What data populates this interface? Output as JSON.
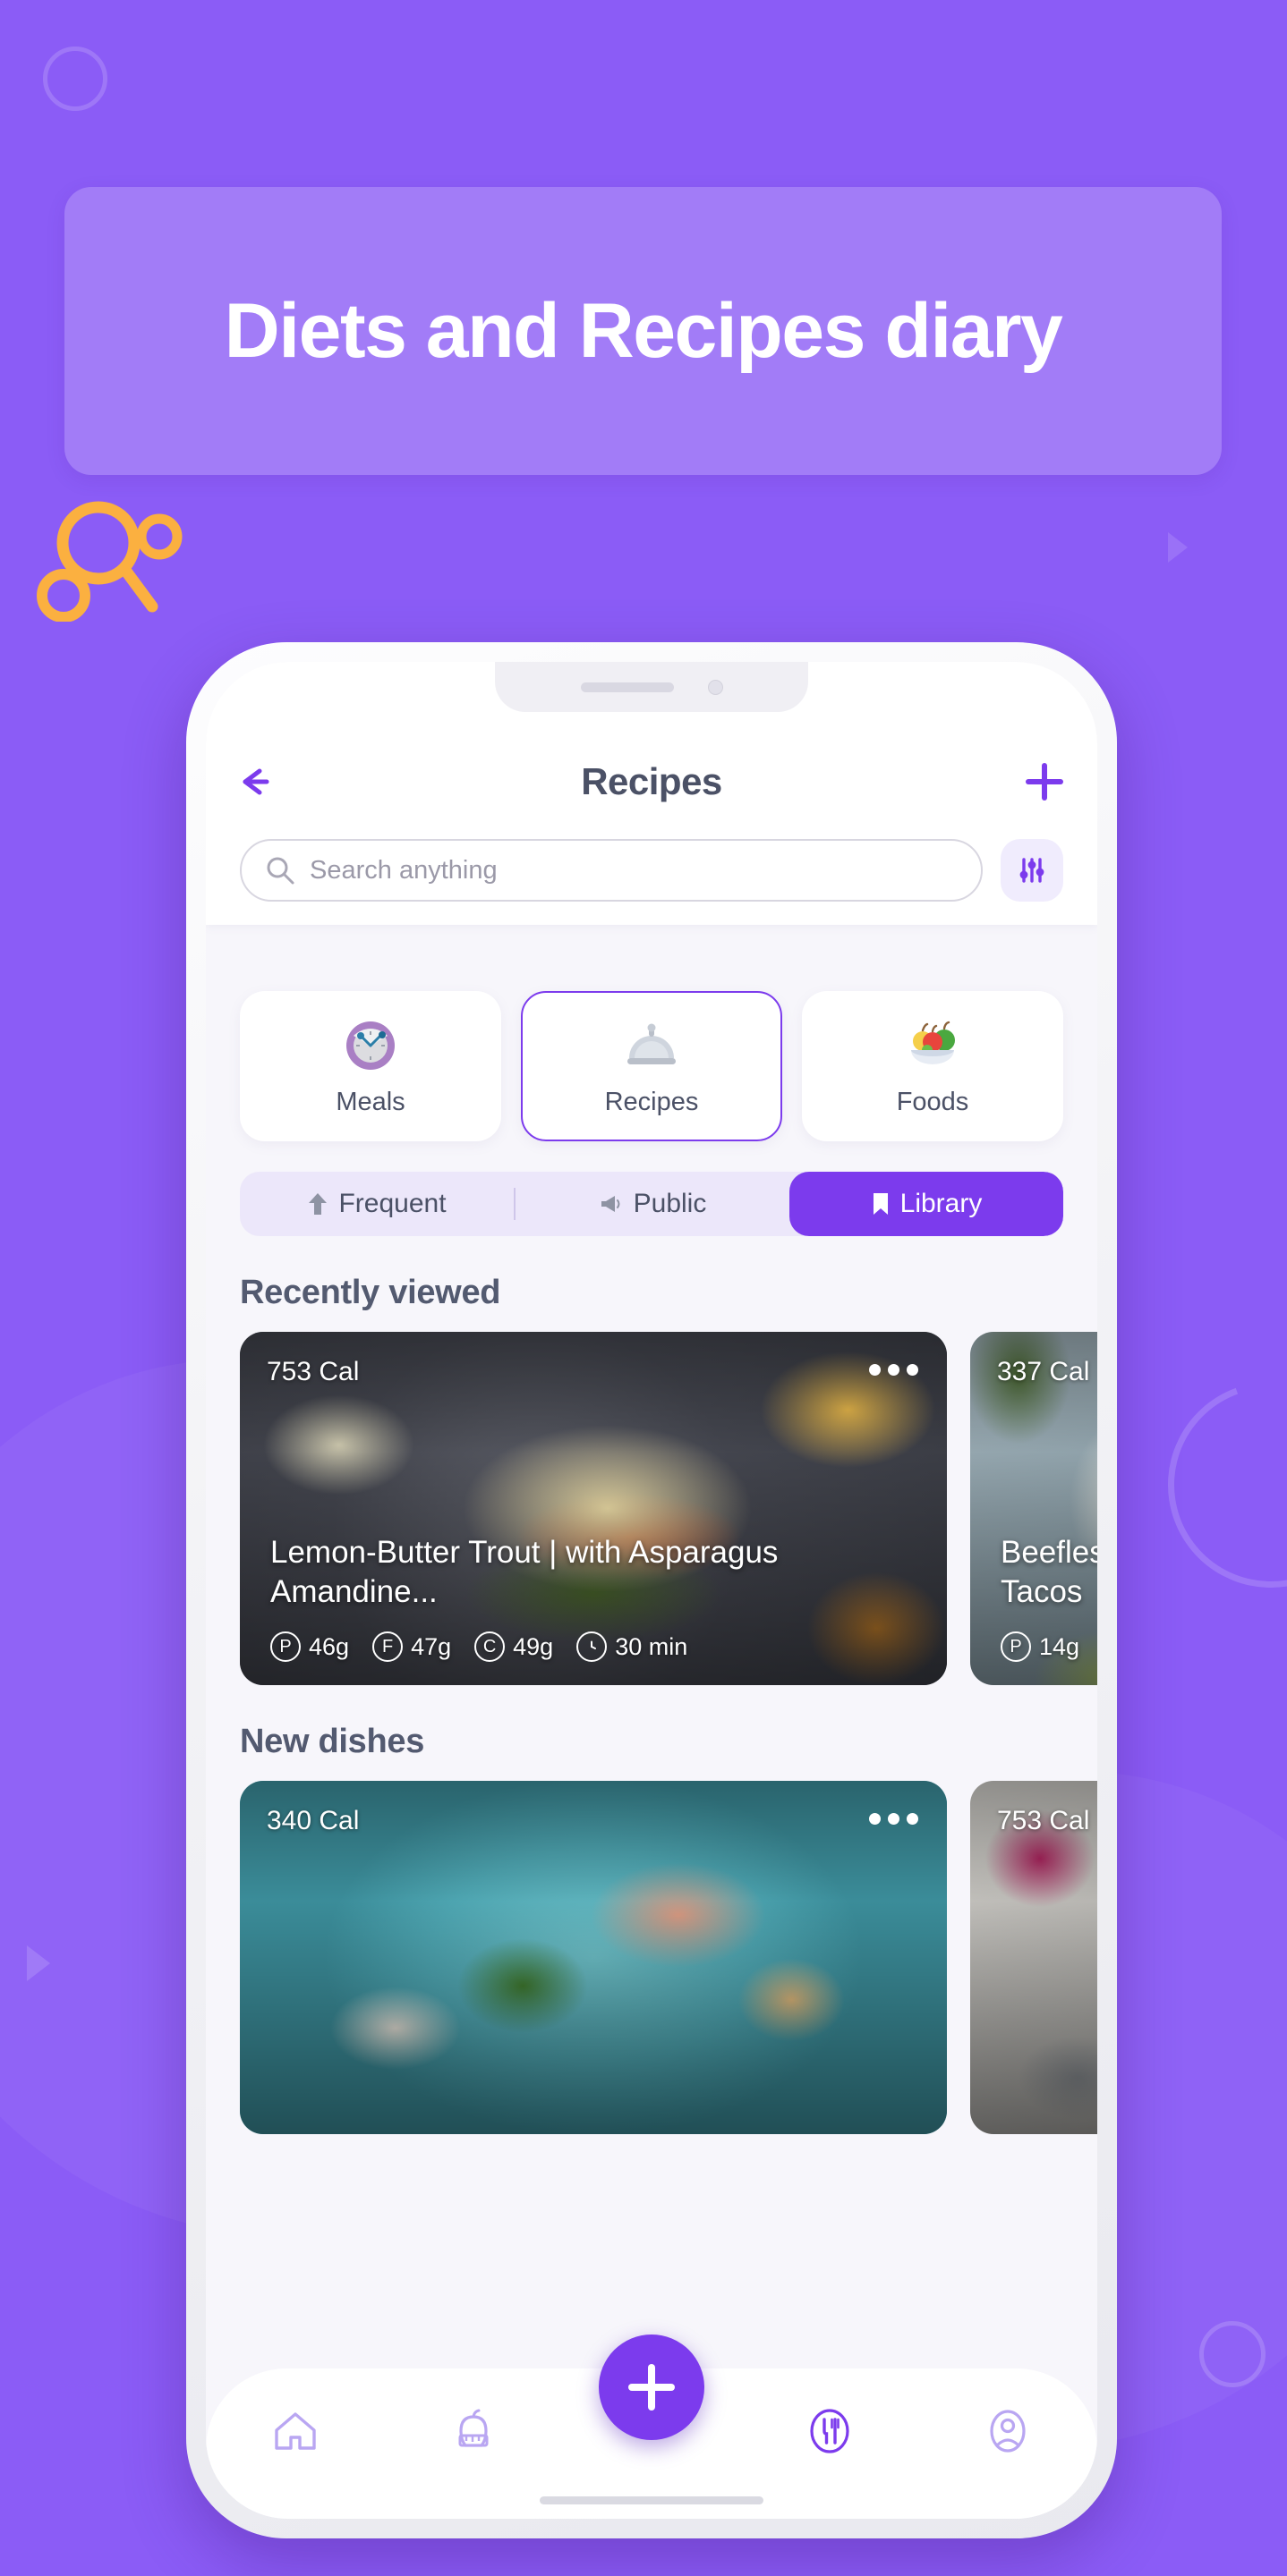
{
  "hero": {
    "title": "Diets and Recipes diary",
    "banner_bg": "rgba(255,255,255,0.20)"
  },
  "theme": {
    "page_bg": "#8B5CF6",
    "accent": "#7C3BED",
    "accent_soft": "#ECE7FA",
    "decor_orange": "#FBB040",
    "screen_bg": "#F7F6FB",
    "text_dark": "#4B5166"
  },
  "app": {
    "header": {
      "back_icon": "arrow-left-icon",
      "title": "Recipes",
      "add_icon": "plus-icon"
    },
    "search": {
      "icon": "search-icon",
      "placeholder": "Search anything",
      "value": "",
      "filter_icon": "sliders-icon"
    },
    "categories": [
      {
        "label": "Meals",
        "icon": "clock-icon",
        "active": false
      },
      {
        "label": "Recipes",
        "icon": "cloche-icon",
        "active": true
      },
      {
        "label": "Foods",
        "icon": "fruit-bowl-icon",
        "active": false
      }
    ],
    "segments": [
      {
        "label": "Frequent",
        "icon": "arrow-up-icon",
        "active": false
      },
      {
        "label": "Public",
        "icon": "megaphone-icon",
        "active": false
      },
      {
        "label": "Library",
        "icon": "bookmark-icon",
        "active": true
      }
    ],
    "sections": [
      {
        "title": "Recently viewed",
        "cards": [
          {
            "calories": "753 Cal",
            "title": "Lemon-Butter Trout | with Asparagus Amandine...",
            "menu_icon": "more-dots-icon",
            "macros": [
              {
                "key": "P",
                "value": "46g"
              },
              {
                "key": "F",
                "value": "47g"
              },
              {
                "key": "C",
                "value": "49g"
              },
              {
                "key": "clock",
                "value": "30 min"
              }
            ]
          },
          {
            "calories": "337 Cal",
            "title": "Beefless Tacos",
            "menu_icon": "more-dots-icon",
            "macros": [
              {
                "key": "P",
                "value": "14g"
              }
            ]
          }
        ]
      },
      {
        "title": "New dishes",
        "cards": [
          {
            "calories": "340 Cal",
            "title": "",
            "menu_icon": "more-dots-icon",
            "macros": []
          },
          {
            "calories": "753 Cal",
            "title": "",
            "menu_icon": "more-dots-icon",
            "macros": []
          }
        ]
      }
    ],
    "bottom_nav": {
      "items": [
        {
          "icon": "home-icon",
          "active": false
        },
        {
          "icon": "apple-tape-icon",
          "active": false
        },
        {
          "icon": "cutlery-icon",
          "active": true
        },
        {
          "icon": "profile-icon",
          "active": false
        }
      ],
      "fab_icon": "plus-icon"
    }
  }
}
